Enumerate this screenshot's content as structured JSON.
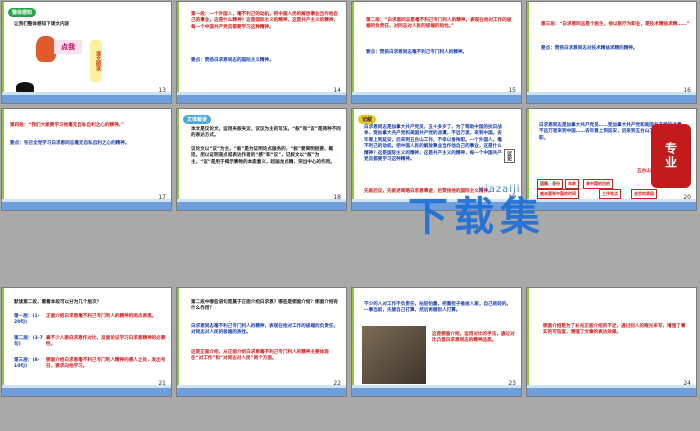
{
  "slides": [
    {
      "num": "13",
      "badge": "整体感知",
      "line1": "让我们整体感知下课文内容",
      "card1": "点我",
      "card2": "课文朗读"
    },
    {
      "num": "14",
      "p1": "第一段：一个外国人，毫不利己的动机，把中国人民的解放事业当作他自己的事业，这是什么精神？这是国际主义的精神，这是共产主义的精神，每一个中国共产党员都要学习这种精神。",
      "p2": "要点：赞扬白求恩同志的国际主义精神。"
    },
    {
      "num": "15",
      "p1": "第二段：“白求恩同志是毫不利己专门利人的精神，表现在他对工作的极端的负责任，对同志对人民的极端的热忱。”",
      "p2": "要点：赞扬白求恩同志毫不利己专门利人的精神。"
    },
    {
      "num": "16",
      "p1": "第三段：“白求恩同志是个医生，他以医疗为职业，是技术精益求精……”",
      "p2": "要点：赞扬白求恩同志对技术精益求精的精神。"
    },
    {
      "num": "17",
      "p1": "第四段：“我们大家要学习他毫无自私自利之心的精神。”",
      "p2": "要点：号召全党学习白求恩同志毫无自私自利之心的精神。"
    },
    {
      "num": "18",
      "badge": "文体解读",
      "p1": "本文是议论文，运用夹叙夹议，议议为主的写法。“叙”和“议”是两种不同的表达方式。",
      "p2": "议论文以“议”为主，“叙”是为证明论点服务的，“叙”要简明扼要、概括，用以证明观点或表达作者的“感”和“议”，记叙文以“叙”为主，“议”是用于揭示事物的本质意义，起画龙点睛、突出中心的作用。"
    },
    {
      "num": "19",
      "badge": "记叙",
      "p1": "白求恩同志是加拿大共产党员，五十多岁了，为了帮助中国的抗日战争，受加拿大共产党和美国共产党的派遣，不远万里，来到中国。去年春上到延安，后来到五台山工作，不幸以身殉职。一个外国人，毫不利己的动机，把中国人民的解放事业当作他自己的事业，这是什么精神？这是国际主义的精神，这是共产主义的精神，每一个中国共产党员都要学习这种精神。",
      "p2": "先叙后议，先叙述简略白求恩事迹，后赞扬他的国际主义精神。",
      "callout": "议论"
    },
    {
      "num": "20",
      "p1": "白求恩同志是加拿大共产党员……受加拿大共产党和美国共产党的派遣，不远万里来到中国……去年春上到延安，后来到五台山工作，不幸以身殉职。",
      "chips": [
        "国籍、身份",
        "年龄",
        "来中国的目的",
        "被派遣到中国的时间",
        "工作地点",
        "去世的原因"
      ],
      "tag": "五台山"
    },
    {
      "num": "21",
      "q": "默读第二段，看看本段可以分为几个层次？",
      "l1": "第一层：(1-20句)",
      "l1t": "正面介绍白求恩毫不利己专门利人的精神的两点表现。",
      "l2": "第二层：(3-7句)",
      "l2t": "拿不少人跟白求恩作对比，反面论证学习白求恩精神的必要性。",
      "l3": "第三层：(8-10句)",
      "l3t": "侧面介绍白求恩毫不利己专门利人精神的感人之处，发出号召，要求向他学习。"
    },
    {
      "num": "22",
      "p1": "第二段中哪些语句是属于正面介绍白求恩？哪些是侧面介绍？侧面介绍有什么作用？",
      "p2": "白求恩同志毫不利己专门利人的精神，表现在他对工作的极端的负责任，对同志对人民的极端的热忱。",
      "p3": "这是正面介绍，从正面介绍白求恩毫不利己专门利人的精神主要体现在“对工作”和“对同志对人民”两个方面。"
    },
    {
      "num": "23",
      "p1": "不少的人对工作不负责任，拈轻怕重，把重担子推给人家，自己挑轻的。一事当前，先替自己打算，然后再替别人打算。",
      "p2": "这是侧面介绍，运用对比的手法，通过对比凸显白求恩同志的精神品质。"
    },
    {
      "num": "24",
      "p1": "侧面介绍是为了补充正面介绍的不足，通过别人的眼光来写，增强了事实的可信度，增强了文章的表达效果。"
    }
  ],
  "watermark": {
    "main": "下载集",
    "sub": "xiazaiji",
    "seal": "专业"
  }
}
